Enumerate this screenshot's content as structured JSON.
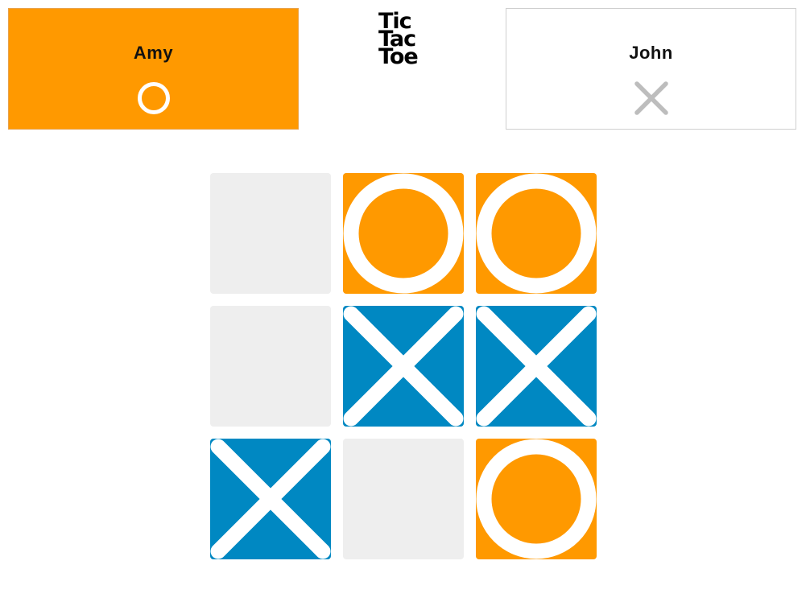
{
  "colors": {
    "o_player": "#ff9900",
    "x_player": "#0088c2",
    "empty_cell": "#eeeeee",
    "mark_stroke": "#ffffff",
    "inactive_mark": "#bdbdbd",
    "inactive_card_bg": "#ffffff"
  },
  "logo": {
    "line1": "Tic",
    "line2": "Tac",
    "line3": "Toe"
  },
  "players": {
    "left": {
      "name": "Amy",
      "mark": "o-icon",
      "active": true
    },
    "right": {
      "name": "John",
      "mark": "x-icon",
      "active": false
    }
  },
  "board": {
    "cells": [
      "",
      "O",
      "O",
      "",
      "X",
      "X",
      "X",
      "",
      "O"
    ]
  }
}
